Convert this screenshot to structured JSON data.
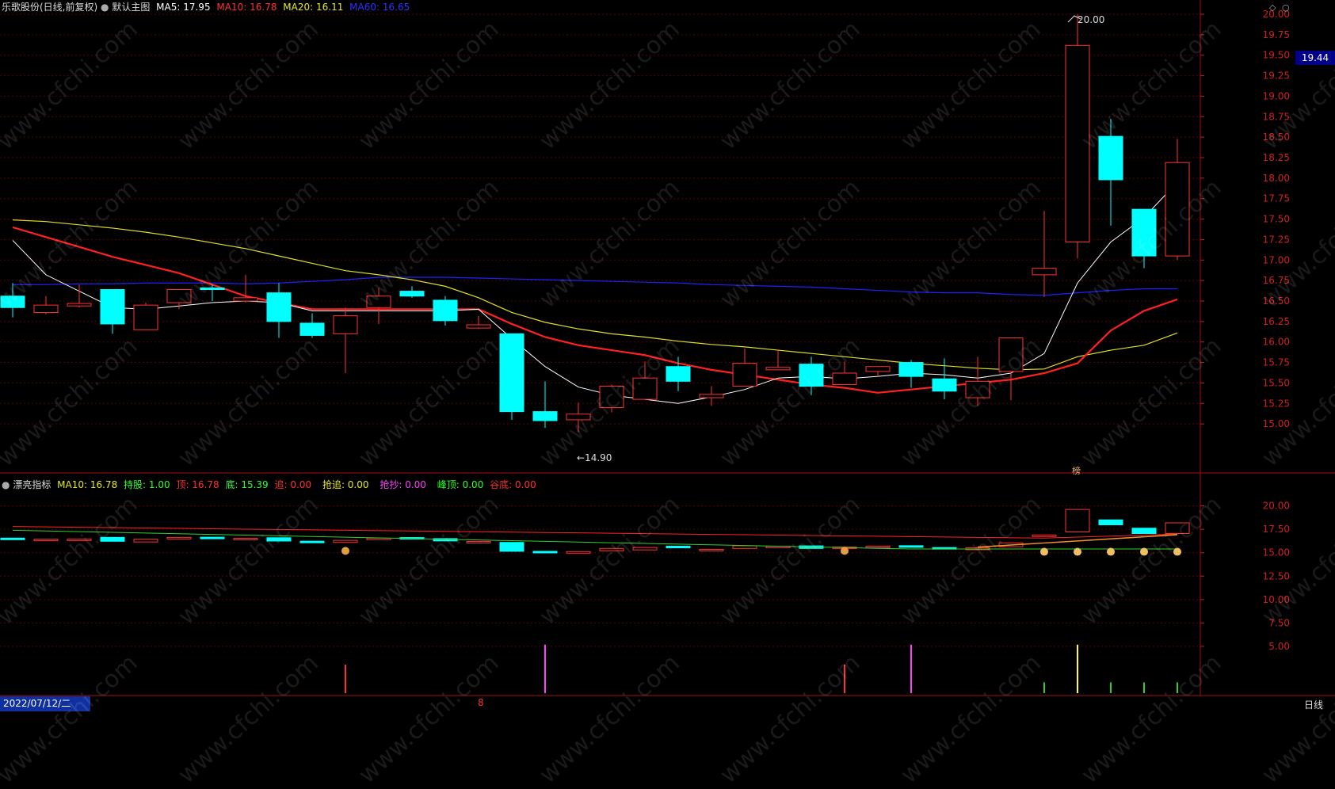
{
  "header": {
    "stock_title": "乐歌股份(日线,前复权)",
    "main_chart_label": "默认主图",
    "ma5": "MA5: 17.95",
    "ma10": "MA10: 16.78",
    "ma20": "MA20: 16.11",
    "ma60": "MA60: 16.65"
  },
  "indicator_header": {
    "name": "漂亮指标",
    "ma10": "MA10: 16.78",
    "hold": "持股: 1.00",
    "top": "顶: 16.78",
    "bottom": "底: 15.39",
    "chase": "追: 0.00",
    "grab_chase": "抢追: 0.00",
    "grab_bottom": "抢抄: 0.00",
    "peak": "峰顶: 0.00",
    "valley_bottom": "谷底: 0.00"
  },
  "annotations": {
    "high_label": "20.00",
    "low_label": "←14.90",
    "last_price": "19.44",
    "dragon_tag": "榜"
  },
  "footer": {
    "date": "2022/07/12/二",
    "month_marker": "8",
    "period": "日线"
  },
  "watermark": "www.cfchi.com",
  "colors": {
    "up": "#ff3232",
    "down": "#00ffff",
    "ma5": "#ffffff",
    "ma10": "#ff2020",
    "ma20": "#e0e020",
    "ma60": "#2020ff"
  },
  "chart_data": {
    "type": "candlestick",
    "main_axis": {
      "ylim": [
        14.6,
        20.1
      ],
      "ticks": [
        "20.00",
        "19.75",
        "19.50",
        "19.25",
        "19.00",
        "18.75",
        "18.50",
        "18.25",
        "18.00",
        "17.75",
        "17.50",
        "17.25",
        "17.00",
        "16.75",
        "16.50",
        "16.25",
        "16.00",
        "15.75",
        "15.50",
        "15.25",
        "15.00"
      ]
    },
    "indicator_axis": {
      "ylim": [
        0,
        22
      ],
      "ticks": [
        "20.00",
        "17.50",
        "15.00",
        "12.50",
        "10.00",
        "7.50",
        "5.00"
      ]
    },
    "candles": [
      {
        "o": 16.56,
        "h": 16.72,
        "l": 16.3,
        "c": 16.42
      },
      {
        "o": 16.36,
        "h": 16.56,
        "l": 16.34,
        "c": 16.45
      },
      {
        "o": 16.44,
        "h": 16.7,
        "l": 16.42,
        "c": 16.47
      },
      {
        "o": 16.64,
        "h": 16.64,
        "l": 16.1,
        "c": 16.22
      },
      {
        "o": 16.15,
        "h": 16.48,
        "l": 16.15,
        "c": 16.45
      },
      {
        "o": 16.48,
        "h": 16.64,
        "l": 16.4,
        "c": 16.64
      },
      {
        "o": 16.66,
        "h": 16.7,
        "l": 16.5,
        "c": 16.64
      },
      {
        "o": 16.5,
        "h": 16.82,
        "l": 16.48,
        "c": 16.54
      },
      {
        "o": 16.6,
        "h": 16.72,
        "l": 16.05,
        "c": 16.25
      },
      {
        "o": 16.23,
        "h": 16.35,
        "l": 16.05,
        "c": 16.08
      },
      {
        "o": 16.1,
        "h": 16.42,
        "l": 15.62,
        "c": 16.32
      },
      {
        "o": 16.42,
        "h": 16.66,
        "l": 16.22,
        "c": 16.56
      },
      {
        "o": 16.62,
        "h": 16.68,
        "l": 16.54,
        "c": 16.56
      },
      {
        "o": 16.51,
        "h": 16.56,
        "l": 16.2,
        "c": 16.26
      },
      {
        "o": 16.17,
        "h": 16.32,
        "l": 16.16,
        "c": 16.21
      },
      {
        "o": 16.1,
        "h": 16.1,
        "l": 15.05,
        "c": 15.15
      },
      {
        "o": 15.15,
        "h": 15.52,
        "l": 14.95,
        "c": 15.04
      },
      {
        "o": 15.05,
        "h": 15.26,
        "l": 14.9,
        "c": 15.12
      },
      {
        "o": 15.2,
        "h": 15.48,
        "l": 15.14,
        "c": 15.46
      },
      {
        "o": 15.3,
        "h": 15.76,
        "l": 15.3,
        "c": 15.56
      },
      {
        "o": 15.7,
        "h": 15.82,
        "l": 15.4,
        "c": 15.52
      },
      {
        "o": 15.32,
        "h": 15.46,
        "l": 15.22,
        "c": 15.36
      },
      {
        "o": 15.46,
        "h": 15.92,
        "l": 15.46,
        "c": 15.74
      },
      {
        "o": 15.66,
        "h": 15.91,
        "l": 15.66,
        "c": 15.69
      },
      {
        "o": 15.73,
        "h": 15.82,
        "l": 15.35,
        "c": 15.46
      },
      {
        "o": 15.48,
        "h": 15.76,
        "l": 15.48,
        "c": 15.62
      },
      {
        "o": 15.64,
        "h": 15.7,
        "l": 15.58,
        "c": 15.7
      },
      {
        "o": 15.75,
        "h": 15.78,
        "l": 15.44,
        "c": 15.58
      },
      {
        "o": 15.55,
        "h": 15.8,
        "l": 15.3,
        "c": 15.4
      },
      {
        "o": 15.32,
        "h": 15.82,
        "l": 15.22,
        "c": 15.52
      },
      {
        "o": 15.64,
        "h": 16.05,
        "l": 15.29,
        "c": 16.05
      },
      {
        "o": 16.82,
        "h": 17.6,
        "l": 16.55,
        "c": 16.9
      },
      {
        "o": 17.22,
        "h": 20.0,
        "l": 17.02,
        "c": 19.62
      },
      {
        "o": 18.51,
        "h": 18.72,
        "l": 17.42,
        "c": 17.98
      },
      {
        "o": 17.62,
        "h": 17.62,
        "l": 16.9,
        "c": 17.05
      },
      {
        "o": 17.05,
        "h": 18.48,
        "l": 17.0,
        "c": 18.19
      }
    ],
    "ma5": [
      17.24,
      16.82,
      16.62,
      16.42,
      16.4,
      16.44,
      16.48,
      16.5,
      16.48,
      16.38,
      16.38,
      16.38,
      16.38,
      16.38,
      16.4,
      16.04,
      15.7,
      15.45,
      15.35,
      15.3,
      15.25,
      15.33,
      15.42,
      15.56,
      15.58,
      15.55,
      15.58,
      15.62,
      15.6,
      15.56,
      15.62,
      15.86,
      16.72,
      17.22,
      17.52,
      17.95
    ],
    "ma10": [
      17.4,
      17.28,
      17.16,
      17.04,
      16.94,
      16.84,
      16.7,
      16.56,
      16.48,
      16.4,
      16.4,
      16.4,
      16.4,
      16.4,
      16.4,
      16.22,
      16.06,
      15.96,
      15.9,
      15.84,
      15.74,
      15.66,
      15.6,
      15.54,
      15.48,
      15.44,
      15.38,
      15.42,
      15.46,
      15.5,
      15.54,
      15.62,
      15.74,
      16.14,
      16.38,
      16.52,
      16.78
    ],
    "ma20": [
      17.49,
      17.47,
      17.43,
      17.39,
      17.34,
      17.28,
      17.21,
      17.14,
      17.05,
      16.96,
      16.87,
      16.82,
      16.76,
      16.68,
      16.54,
      16.36,
      16.24,
      16.16,
      16.1,
      16.06,
      16.01,
      15.97,
      15.94,
      15.9,
      15.86,
      15.82,
      15.78,
      15.74,
      15.71,
      15.68,
      15.66,
      15.67,
      15.82,
      15.9,
      15.96,
      16.11
    ],
    "ma60": [
      16.7,
      16.7,
      16.71,
      16.71,
      16.72,
      16.72,
      16.72,
      16.71,
      16.72,
      16.74,
      16.76,
      16.79,
      16.79,
      16.79,
      16.78,
      16.77,
      16.76,
      16.75,
      16.74,
      16.73,
      16.72,
      16.7,
      16.69,
      16.68,
      16.67,
      16.65,
      16.63,
      16.61,
      16.6,
      16.6,
      16.58,
      16.57,
      16.6,
      16.63,
      16.65,
      16.65
    ],
    "ind_top": [
      17.7,
      17.6,
      17.5,
      17.4,
      17.3,
      17.2,
      17.1,
      17.0,
      16.9,
      16.8,
      16.7,
      16.6,
      16.5,
      16.5,
      16.6,
      16.7,
      16.8,
      16.8
    ],
    "ind_bottom": [
      17.4,
      17.2,
      17.0,
      16.8,
      16.7,
      16.5,
      16.3,
      16.1,
      15.9,
      15.8,
      15.6,
      15.5,
      15.4,
      15.4,
      15.4,
      15.4,
      15.4,
      15.4,
      15.4
    ],
    "volume_bars": [
      {
        "i": 10,
        "v": 4.0,
        "color": "#ff3232"
      },
      {
        "i": 16,
        "v": 6.8,
        "color": "#ff40ff"
      },
      {
        "i": 25,
        "v": 4.0,
        "color": "#ff3232"
      },
      {
        "i": 27,
        "v": 6.8,
        "color": "#ff40ff"
      },
      {
        "i": 31,
        "v": 1.5,
        "color": "#30d030"
      },
      {
        "i": 32,
        "v": 6.8,
        "color": "#ffff20"
      },
      {
        "i": 33,
        "v": 1.5,
        "color": "#30d030"
      },
      {
        "i": 34,
        "v": 1.5,
        "color": "#30d030"
      },
      {
        "i": 35,
        "v": 1.5,
        "color": "#30d030"
      }
    ]
  }
}
